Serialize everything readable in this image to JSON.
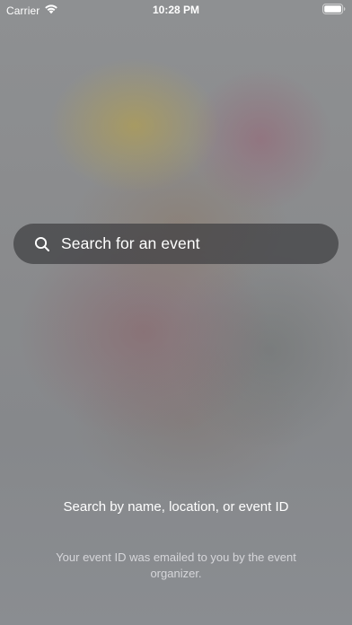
{
  "status_bar": {
    "carrier": "Carrier",
    "time": "10:28 PM",
    "icons": [
      "wifi-icon",
      "battery-icon"
    ]
  },
  "search": {
    "placeholder": "Search for an event",
    "icon": "search-icon"
  },
  "help": {
    "title": "Search by name, location, or event ID",
    "subtitle": "Your event ID was emailed to you by the event organizer."
  },
  "colors": {
    "text": "#ffffff",
    "search_bg": "#3e3f41"
  }
}
